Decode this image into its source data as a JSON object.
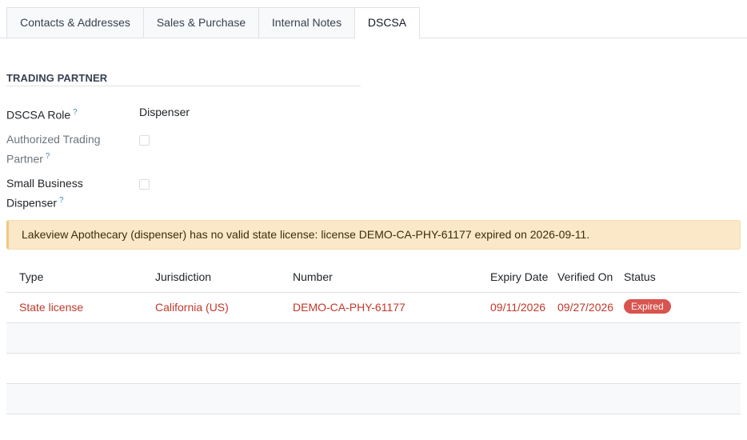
{
  "tabs": [
    {
      "label": "Contacts & Addresses"
    },
    {
      "label": "Sales & Purchase"
    },
    {
      "label": "Internal Notes"
    },
    {
      "label": "DSCSA"
    }
  ],
  "section": {
    "title": "TRADING PARTNER"
  },
  "fields": {
    "dscsa_role": {
      "label": "DSCSA Role",
      "value": "Dispenser",
      "help": "?"
    },
    "authorized_trading_partner": {
      "label_line1": "Authorized Trading",
      "label_line2": "Partner",
      "help": "?",
      "checked": false
    },
    "small_business_dispenser": {
      "label_line1": "Small Business",
      "label_line2": "Dispenser",
      "help": "?",
      "checked": false
    }
  },
  "alert": {
    "message": "Lakeview Apothecary (dispenser) has no valid state license: license DEMO-CA-PHY-61177 expired on 2026-09-11."
  },
  "license_table": {
    "columns": [
      "Type",
      "Jurisdiction",
      "Number",
      "Expiry Date",
      "Verified On",
      "Status"
    ],
    "rows": [
      {
        "type": "State license",
        "jurisdiction": "California (US)",
        "number": "DEMO-CA-PHY-61177",
        "expiry_date": "09/11/2026",
        "verified_on": "09/27/2026",
        "status": "Expired"
      }
    ]
  },
  "colors": {
    "accent_link": "#3a8bbb",
    "danger_text": "#c0392b",
    "expired_badge": "#d9534f",
    "alert_background": "#fbe8c9"
  }
}
